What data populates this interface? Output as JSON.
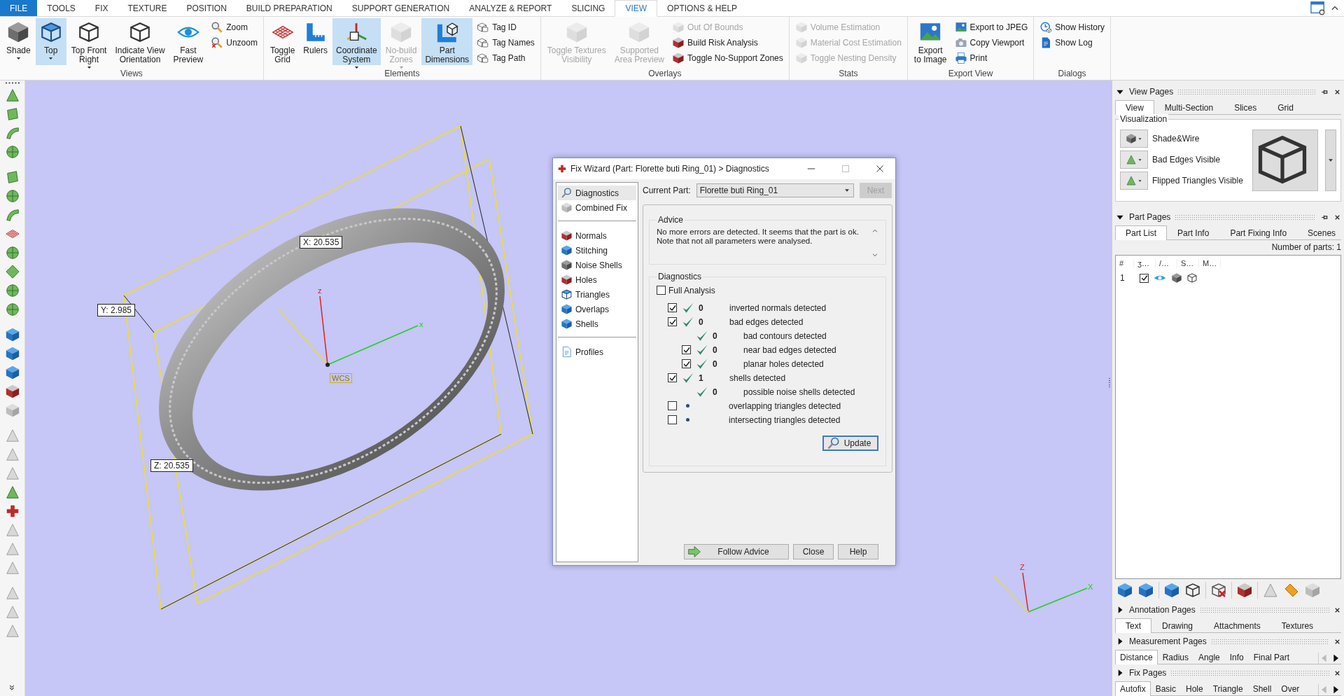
{
  "menu_tabs": [
    {
      "label": "FILE",
      "kind": "file",
      "selected": false
    },
    {
      "label": "TOOLS",
      "kind": "tab",
      "selected": false
    },
    {
      "label": "FIX",
      "kind": "tab",
      "selected": false
    },
    {
      "label": "TEXTURE",
      "kind": "tab",
      "selected": false
    },
    {
      "label": "POSITION",
      "kind": "tab",
      "selected": false
    },
    {
      "label": "BUILD PREPARATION",
      "kind": "tab",
      "selected": false
    },
    {
      "label": "SUPPORT GENERATION",
      "kind": "tab",
      "selected": false
    },
    {
      "label": "ANALYZE & REPORT",
      "kind": "tab",
      "selected": false
    },
    {
      "label": "SLICING",
      "kind": "tab",
      "selected": false
    },
    {
      "label": "VIEW",
      "kind": "tab",
      "selected": true
    },
    {
      "label": "OPTIONS & HELP",
      "kind": "tab",
      "selected": false
    }
  ],
  "ribbon_groups": [
    {
      "title": "Views",
      "items": [
        {
          "label": "Shade",
          "kind": "large",
          "dropdown": true,
          "pressed": false,
          "disabled": false
        },
        {
          "label": "Top",
          "kind": "large",
          "dropdown": true,
          "pressed": true,
          "disabled": false
        },
        {
          "label": "Top Front\nRight",
          "kind": "large",
          "dropdown": true,
          "pressed": false,
          "disabled": false
        },
        {
          "label": "Indicate View\nOrientation",
          "kind": "large",
          "dropdown": false,
          "pressed": false,
          "disabled": false
        },
        {
          "label": "Fast\nPreview",
          "kind": "large",
          "dropdown": false,
          "pressed": false,
          "disabled": false
        },
        {
          "label": "Zoom",
          "kind": "small",
          "pressed": false,
          "disabled": false
        },
        {
          "label": "Unzoom",
          "kind": "small",
          "pressed": false,
          "disabled": false
        }
      ]
    },
    {
      "title": "Elements",
      "items": [
        {
          "label": "Toggle\nGrid",
          "kind": "large",
          "dropdown": false,
          "pressed": false,
          "disabled": false
        },
        {
          "label": "Rulers",
          "kind": "large",
          "dropdown": false,
          "pressed": false,
          "disabled": false
        },
        {
          "label": "Coordinate\nSystem",
          "kind": "large",
          "dropdown": true,
          "pressed": true,
          "disabled": false
        },
        {
          "label": "No-build\nZones",
          "kind": "large",
          "dropdown": true,
          "pressed": false,
          "disabled": true
        },
        {
          "label": "Part\nDimensions",
          "kind": "large",
          "dropdown": false,
          "pressed": true,
          "disabled": false
        },
        {
          "label": "Tag ID",
          "kind": "small",
          "pressed": false,
          "disabled": false
        },
        {
          "label": "Tag Names",
          "kind": "small",
          "pressed": false,
          "disabled": false
        },
        {
          "label": "Tag Path",
          "kind": "small",
          "pressed": false,
          "disabled": false
        }
      ]
    },
    {
      "title": "Overlays",
      "items": [
        {
          "label": "Toggle Textures\nVisibility",
          "kind": "large",
          "dropdown": false,
          "pressed": false,
          "disabled": true
        },
        {
          "label": "Supported\nArea Preview",
          "kind": "large",
          "dropdown": false,
          "pressed": false,
          "disabled": true
        },
        {
          "label": "Out Of Bounds",
          "kind": "small",
          "pressed": false,
          "disabled": true
        },
        {
          "label": "Build Risk Analysis",
          "kind": "small",
          "pressed": false,
          "disabled": false
        },
        {
          "label": "Toggle No-Support Zones",
          "kind": "small",
          "pressed": false,
          "disabled": false
        }
      ]
    },
    {
      "title": "Stats",
      "items": [
        {
          "label": "Volume Estimation",
          "kind": "small",
          "pressed": false,
          "disabled": true
        },
        {
          "label": "Material Cost Estimation",
          "kind": "small",
          "pressed": false,
          "disabled": true
        },
        {
          "label": "Toggle Nesting Density",
          "kind": "small",
          "pressed": false,
          "disabled": true
        }
      ]
    },
    {
      "title": "Export View",
      "items": [
        {
          "label": "Export\nto Image",
          "kind": "large",
          "dropdown": false,
          "pressed": false,
          "disabled": false
        },
        {
          "label": "Export to JPEG",
          "kind": "small",
          "pressed": false,
          "disabled": false
        },
        {
          "label": "Copy Viewport",
          "kind": "small",
          "pressed": false,
          "disabled": false
        },
        {
          "label": "Print",
          "kind": "small",
          "pressed": false,
          "disabled": false
        }
      ]
    },
    {
      "title": "Dialogs",
      "items": [
        {
          "label": "Show History",
          "kind": "small",
          "pressed": false,
          "disabled": false
        },
        {
          "label": "Show Log",
          "kind": "small",
          "pressed": false,
          "disabled": false
        }
      ]
    }
  ],
  "left_toolbar": {
    "more": "»"
  },
  "viewport": {
    "dimension_labels": [
      "X: 20.535",
      "Y: 2.985",
      "Z: 20.535"
    ],
    "origin_label": "WCS",
    "center_axis_labels": [
      "z",
      "x"
    ],
    "corner_axis_labels": [
      "Z",
      "X"
    ]
  },
  "fix_wizard": {
    "title": "Fix Wizard (Part: Florette buti Ring_01) > Diagnostics",
    "nav_groups": [
      {
        "items": [
          {
            "label": "Diagnostics",
            "selected": true
          },
          {
            "label": "Combined Fix",
            "selected": false
          }
        ]
      },
      {
        "items": [
          {
            "label": "Normals",
            "selected": false
          },
          {
            "label": "Stitching",
            "selected": false
          },
          {
            "label": "Noise Shells",
            "selected": false
          },
          {
            "label": "Holes",
            "selected": false
          },
          {
            "label": "Triangles",
            "selected": false
          },
          {
            "label": "Overlaps",
            "selected": false
          },
          {
            "label": "Shells",
            "selected": false
          }
        ]
      },
      {
        "items": [
          {
            "label": "Profiles",
            "selected": false
          }
        ]
      }
    ],
    "current_part_label": "Current Part:",
    "current_part": "Florette buti Ring_01",
    "next_button": {
      "label": "Next",
      "disabled": true
    },
    "advice": {
      "title": "Advice",
      "text": "No more errors are detected. It seems that the part is ok.\nNote that not all parameters were analysed."
    },
    "diagnostics": {
      "title": "Diagnostics",
      "full_analysis": {
        "label": "Full Analysis",
        "checked": false
      },
      "rows": [
        {
          "kind": "check",
          "checked": true,
          "passed": true,
          "count": "0",
          "label": "inverted normals detected"
        },
        {
          "kind": "check",
          "checked": true,
          "passed": true,
          "count": "0",
          "label": "bad edges detected",
          "children": [
            {
              "kind": "info",
              "passed": true,
              "count": "0",
              "label": "bad contours detected"
            },
            {
              "kind": "check",
              "checked": true,
              "passed": true,
              "count": "0",
              "label": "near bad edges detected"
            },
            {
              "kind": "check",
              "checked": true,
              "passed": true,
              "count": "0",
              "label": "planar holes detected"
            }
          ]
        },
        {
          "kind": "check",
          "checked": true,
          "passed": true,
          "count": "1",
          "label": "shells detected",
          "children": [
            {
              "kind": "info",
              "passed": true,
              "count": "0",
              "label": "possible noise shells detected"
            }
          ]
        },
        {
          "kind": "check",
          "checked": false,
          "passed": false,
          "label": "overlapping triangles detected"
        },
        {
          "kind": "check",
          "checked": false,
          "passed": false,
          "label": "intersecting triangles detected"
        }
      ],
      "update_button": "Update"
    },
    "buttons": [
      {
        "label": "Follow Advice",
        "kind": "arrow"
      },
      {
        "label": "Close",
        "kind": "plain"
      },
      {
        "label": "Help",
        "kind": "plain"
      }
    ]
  },
  "side_panels": [
    {
      "title": "View Pages",
      "kind": "view",
      "expanded": true,
      "scrollable": false,
      "tabs": [
        {
          "label": "View",
          "selected": true
        },
        {
          "label": "Multi-Section",
          "selected": false
        },
        {
          "label": "Slices",
          "selected": false
        },
        {
          "label": "Grid",
          "selected": false
        }
      ],
      "group_title": "Visualization",
      "options": [
        "Shade&Wire",
        "Bad Edges Visible",
        "Flipped Triangles Visible"
      ]
    },
    {
      "title": "Part Pages",
      "kind": "parts",
      "expanded": true,
      "scrollable": false,
      "tabs": [
        {
          "label": "Part List",
          "selected": true
        },
        {
          "label": "Part Info",
          "selected": false
        },
        {
          "label": "Part Fixing Info",
          "selected": false
        },
        {
          "label": "Scenes",
          "selected": false
        }
      ],
      "part_count": "Number of parts: 1",
      "columns": [
        "#",
        "ʒ…",
        "/…",
        "S…",
        "M…"
      ],
      "rows": [
        {
          "number": "1",
          "checked": true
        }
      ]
    },
    {
      "title": "Annotation Pages",
      "kind": "tabs",
      "expanded": false,
      "scrollable": false,
      "tabs": [
        {
          "label": "Text",
          "selected": true
        },
        {
          "label": "Drawing",
          "selected": false
        },
        {
          "label": "Attachments",
          "selected": false
        },
        {
          "label": "Textures",
          "selected": false
        }
      ]
    },
    {
      "title": "Measurement Pages",
      "kind": "tabs",
      "expanded": false,
      "scrollable": true,
      "tabs": [
        {
          "label": "Distance",
          "selected": true
        },
        {
          "label": "Radius",
          "selected": false
        },
        {
          "label": "Angle",
          "selected": false
        },
        {
          "label": "Info",
          "selected": false
        },
        {
          "label": "Final Part",
          "selected": false
        }
      ]
    },
    {
      "title": "Fix Pages",
      "kind": "tabs",
      "expanded": false,
      "scrollable": true,
      "tabs": [
        {
          "label": "Autofix",
          "selected": true
        },
        {
          "label": "Basic",
          "selected": false
        },
        {
          "label": "Hole",
          "selected": false
        },
        {
          "label": "Triangle",
          "selected": false
        },
        {
          "label": "Shell",
          "selected": false
        },
        {
          "label": "Over",
          "selected": false
        }
      ]
    }
  ]
}
